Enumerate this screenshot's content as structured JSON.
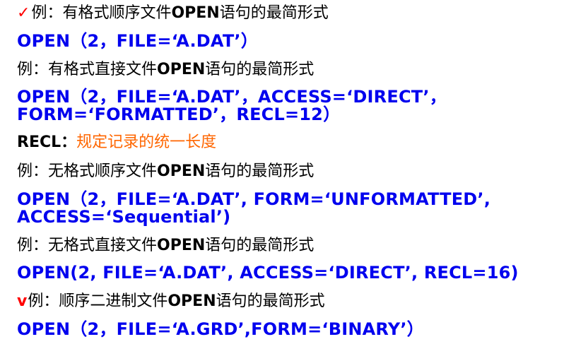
{
  "items": [
    {
      "kind": "heading",
      "mark": "✓",
      "prefix": "例：有格式顺序文件",
      "keyword": "OPEN",
      "suffix": "语句的最简形式"
    },
    {
      "kind": "code",
      "text": "OPEN（2，FILE=‘A.DAT’）"
    },
    {
      "kind": "heading",
      "prefix": "例：有格式直接文件",
      "keyword": "OPEN",
      "suffix": "语句的最简形式"
    },
    {
      "kind": "code",
      "text": "OPEN（2，FILE=‘A.DAT’，ACCESS=‘DIRECT’，"
    },
    {
      "kind": "code",
      "text": "FORM=‘FORMATTED’，RECL=12）"
    },
    {
      "kind": "note",
      "term": "RECL：",
      "desc": "规定记录的统一长度"
    },
    {
      "kind": "heading",
      "prefix": "例：无格式顺序文件",
      "keyword": "OPEN",
      "suffix": "语句的最简形式"
    },
    {
      "kind": "code",
      "text": "OPEN（2，FILE=‘A.DAT’, FORM=‘UNFORMATTED’,"
    },
    {
      "kind": "code",
      "text": "ACCESS=‘Sequential’)"
    },
    {
      "kind": "heading",
      "prefix": "例：无格式直接文件",
      "keyword": "OPEN",
      "suffix": "语句的最简形式"
    },
    {
      "kind": "code",
      "text": "OPEN(2, FILE=‘A.DAT’, ACCESS=‘DIRECT’, RECL=16)"
    },
    {
      "kind": "heading",
      "mark": "v",
      "prefix": "例：顺序二进制文件",
      "keyword": "OPEN",
      "suffix": "语句的最简形式"
    },
    {
      "kind": "code",
      "text": "OPEN（2，FILE=‘A.GRD’,FORM=‘BINARY’）"
    }
  ],
  "colors": {
    "code": "#0000ee",
    "note_desc": "#ff6600",
    "mark": "#ff0000",
    "text": "#000000"
  }
}
